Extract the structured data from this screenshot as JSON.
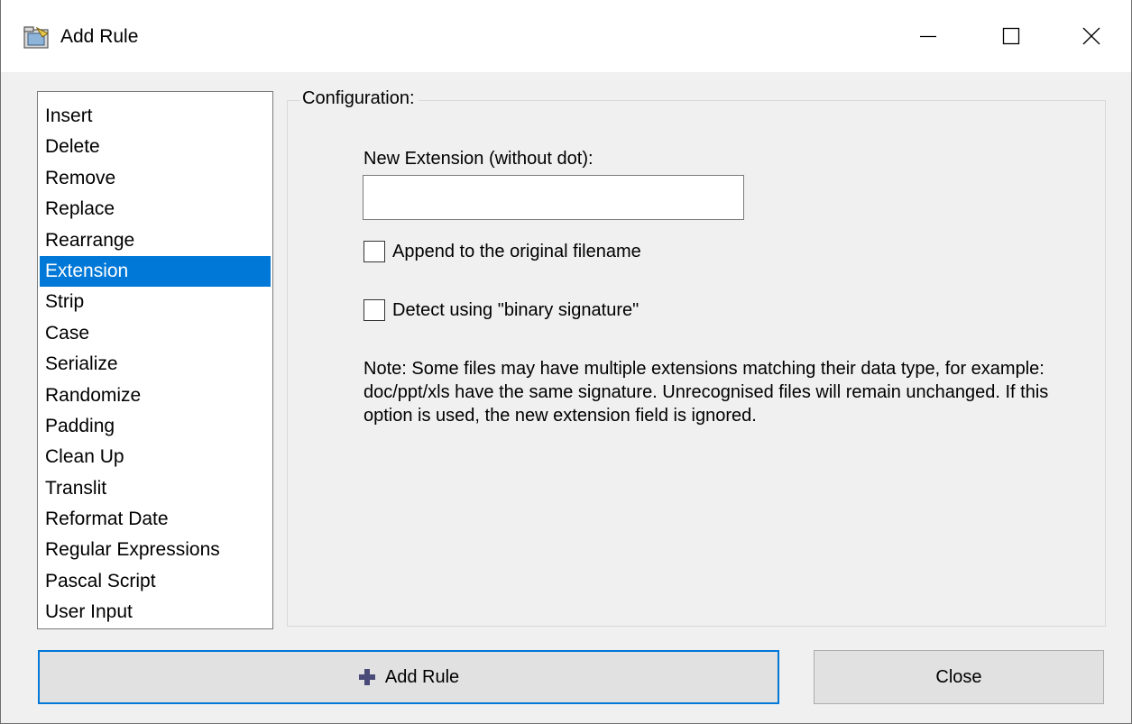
{
  "window": {
    "title": "Add Rule",
    "icon": "rules-folder-icon",
    "controls": [
      "minimize",
      "maximize",
      "close"
    ]
  },
  "rules": {
    "items": [
      "Insert",
      "Delete",
      "Remove",
      "Replace",
      "Rearrange",
      "Extension",
      "Strip",
      "Case",
      "Serialize",
      "Randomize",
      "Padding",
      "Clean Up",
      "Translit",
      "Reformat Date",
      "Regular Expressions",
      "Pascal Script",
      "User Input"
    ],
    "selected": "Extension"
  },
  "configuration": {
    "legend": "Configuration:",
    "new_extension_label": "New Extension (without dot):",
    "new_extension_value": "",
    "append_label": "Append to the original filename",
    "append_checked": false,
    "detect_label": "Detect using \"binary signature\"",
    "detect_checked": false,
    "note": "Note: Some files may have multiple extensions matching their data type, for example: doc/ppt/xls have the same signature. Unrecognised files will remain unchanged. If this option is used, the new extension field is ignored."
  },
  "buttons": {
    "add_rule": "Add Rule",
    "add_rule_icon": "plus-icon",
    "close": "Close"
  },
  "colors": {
    "selection": "#0078d7",
    "focus_border": "#0078d7",
    "plus_icon": "#4a4a78"
  }
}
